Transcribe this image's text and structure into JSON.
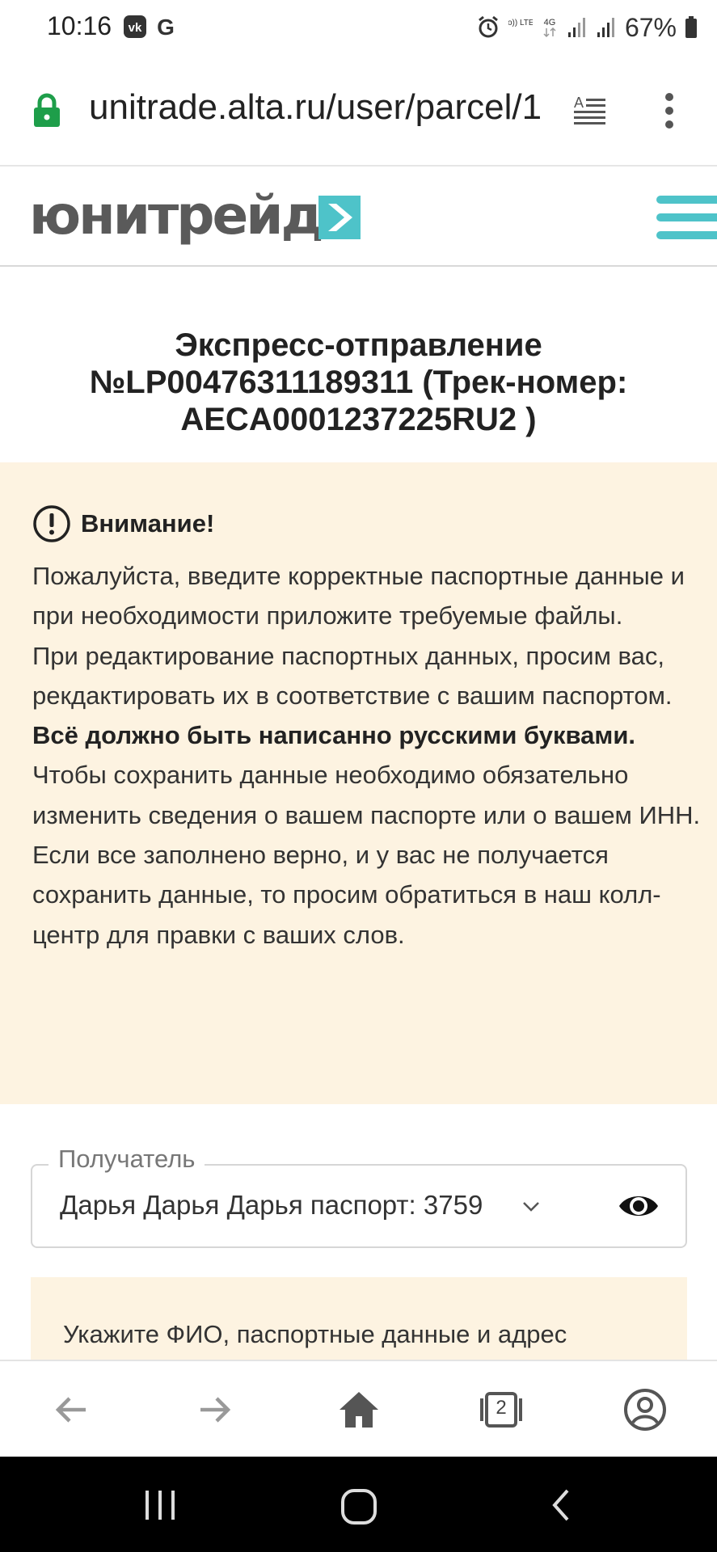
{
  "status_bar": {
    "time": "10:16",
    "app_icons": [
      "vk-icon",
      "google-icon"
    ],
    "network_labels": [
      "Vo)) LTE1",
      "4G"
    ],
    "battery_percent": "67%"
  },
  "browser": {
    "url": "unitrade.alta.ru/user/parcel/1",
    "tab_count": "2"
  },
  "site": {
    "logo_text": "юнитрейд"
  },
  "page": {
    "title": "Экспресс-отправление №LP00476311189311 (Трек-номер: AECA0001237225RU2 )"
  },
  "warning": {
    "title": "Внимание!",
    "line1": "Пожалуйста, введите корректные паспортные данные и при необходимости приложите требуемые файлы.",
    "line2": "При редактирование паспортных данных, просим вас, рекдактировать их в соответствие с вашим паспортом.",
    "line3_bold": "Всё должно быть написанно русскими буквами.",
    "line4": "Чтобы сохранить данные необходимо обязательно изменить сведения о вашем паспорте или о вашем ИНН. Если все заполнено верно, и у вас не получается сохранить данные, то просим обратиться в наш колл-центр для правки с ваших слов."
  },
  "recipient": {
    "label": "Получатель",
    "value": "Дарья Дарья Дарья паспорт: 3759"
  },
  "info": {
    "text": "Укажите ФИО, паспортные данные и адрес"
  },
  "colors": {
    "accent_teal": "#4ec3c9",
    "warning_bg": "#fdf3e1",
    "lock_green": "#1e9e4a"
  }
}
